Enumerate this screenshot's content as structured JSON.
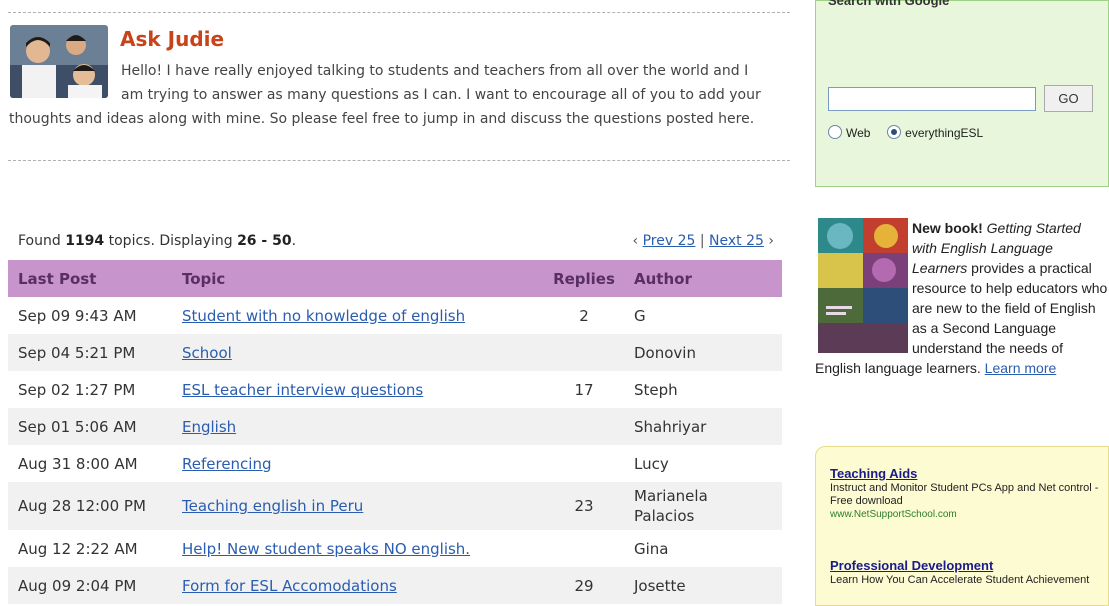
{
  "ask": {
    "title": "Ask Judie",
    "intro": "Hello! I have really enjoyed talking to students and teachers from all over the world and I am trying to answer as many questions as I can. I want to encourage all of you to add your thoughts and ideas along with mine. So please feel free to jump in and discuss the questions posted here."
  },
  "summary": {
    "found_prefix": "Found ",
    "count": "1194",
    "mid": " topics. Displaying ",
    "range": "26 - 50",
    "end": "."
  },
  "pager": {
    "prev_arrow": "‹",
    "prev": "Prev 25",
    "sep": "|",
    "next": "Next 25",
    "next_arrow": "›"
  },
  "table": {
    "headers": {
      "last_post": "Last Post",
      "topic": "Topic",
      "replies": "Replies",
      "author": "Author"
    },
    "rows": [
      {
        "last_post": "Sep 09 9:43 AM",
        "topic": "Student with no knowledge of english",
        "replies": "2",
        "author": "G"
      },
      {
        "last_post": "Sep 04 5:21 PM",
        "topic": "School",
        "replies": "",
        "author": "Donovin"
      },
      {
        "last_post": "Sep 02 1:27 PM",
        "topic": "ESL teacher interview questions",
        "replies": "17",
        "author": "Steph"
      },
      {
        "last_post": "Sep 01 5:06 AM",
        "topic": "English",
        "replies": "",
        "author": "Shahriyar"
      },
      {
        "last_post": "Aug 31 8:00 AM",
        "topic": "Referencing",
        "replies": "",
        "author": "Lucy"
      },
      {
        "last_post": "Aug 28 12:00 PM",
        "topic": "Teaching english in Peru",
        "replies": "23",
        "author": "Marianela Palacios"
      },
      {
        "last_post": "Aug 12 2:22 AM",
        "topic": "Help! New student speaks NO english.",
        "replies": "",
        "author": "Gina"
      },
      {
        "last_post": "Aug 09 2:04 PM",
        "topic": "Form for ESL Accomodations",
        "replies": "29",
        "author": "Josette"
      }
    ]
  },
  "search": {
    "title": "Search with Google",
    "value": "",
    "go": "GO",
    "options": [
      "Web",
      "everythingESL"
    ],
    "selected": "everythingESL"
  },
  "book": {
    "new_label": "New book!",
    "title": "Getting Started with English Language Learners",
    "text": " provides a practical resource to help educators who are new to the field of English as a Second Language understand the needs of English language learners. ",
    "link": "Learn more",
    "cover_icon": "book-cover-image"
  },
  "ads": [
    {
      "title": "Teaching Aids",
      "body": "Instruct and Monitor Student PCs App and Net control - Free download",
      "url": "www.NetSupportSchool.com"
    },
    {
      "title": "Professional Development",
      "body": "Learn How You Can Accelerate Student Achievement",
      "url": ""
    }
  ],
  "colors": {
    "accent": "#c8421a",
    "header_bg": "#c795cc",
    "link": "#2a5db0",
    "search_bg": "#e8f7dc",
    "ad_bg": "#fdfbd2"
  }
}
